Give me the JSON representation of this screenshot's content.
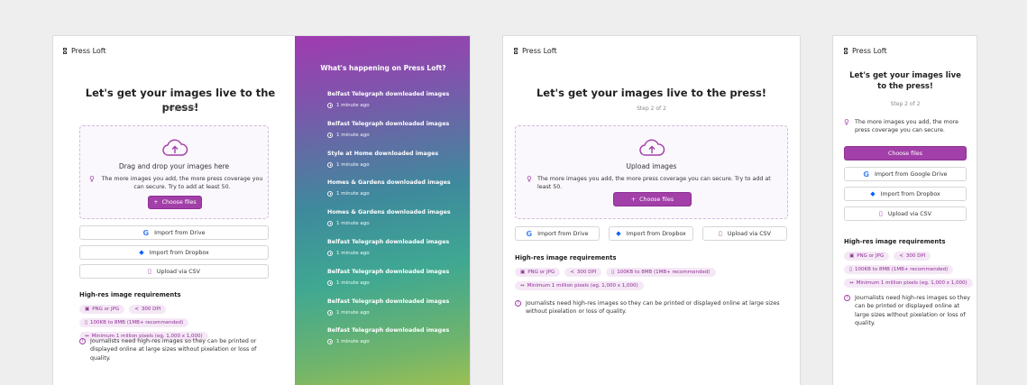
{
  "brand": "Press Loft",
  "heading": "Let's get your images live to the press!",
  "step": "Step 2 of 2",
  "dropzone_title_desktop": "Drag and drop your images here",
  "dropzone_title_tablet": "Upload images",
  "tip": "The more images you add, the more press coverage you can secure. Try to add at least 50.",
  "tip_mobile": "The more images you add, the more press coverage you can secure.",
  "choose_files": "Choose files",
  "import_drive": "Import from Drive",
  "import_google_drive": "Import from Google Drive",
  "import_dropbox": "Import from Dropbox",
  "upload_csv": "Upload via CSV",
  "requirements_title": "High-res image requirements",
  "pills": [
    "PNG or JPG",
    "300 DPI",
    "100KB to 8MB (1MB+ recommended)",
    "Minimum 1 million pixels (eg. 1,000 x 1,000)"
  ],
  "info": "Journalists need high-res images so they can be printed or displayed online at large sizes without pixelation or loss of quality.",
  "feed": {
    "title": "What's happening on Press Loft?",
    "items": [
      {
        "title": "Belfast Telegraph downloaded images",
        "time": "1 minute ago"
      },
      {
        "title": "Belfast Telegraph downloaded images",
        "time": "1 minute ago"
      },
      {
        "title": "Style at Home downloaded images",
        "time": "1 minute ago"
      },
      {
        "title": "Homes & Gardens downloaded images",
        "time": "1 minute ago"
      },
      {
        "title": "Homes & Gardens downloaded images",
        "time": "1 minute ago"
      },
      {
        "title": "Belfast Telegraph downloaded images",
        "time": "1 minute ago"
      },
      {
        "title": "Belfast Telegraph downloaded images",
        "time": "1 minute ago"
      },
      {
        "title": "Belfast Telegraph downloaded images",
        "time": "1 minute ago"
      },
      {
        "title": "Belfast Telegraph downloaded images",
        "time": "1 minute ago"
      }
    ]
  },
  "colors": {
    "accent": "#a23fa8",
    "pill_bg": "#f5e8f6"
  }
}
